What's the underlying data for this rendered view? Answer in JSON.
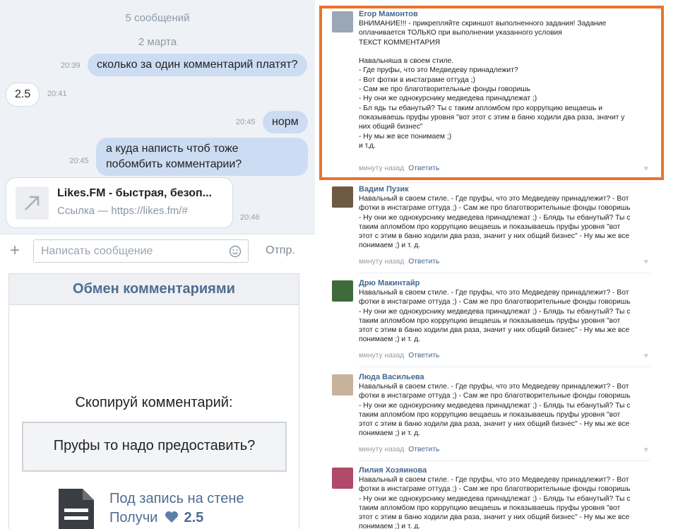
{
  "chat": {
    "header": "5 сообщений",
    "date": "2 марта",
    "messages": [
      {
        "text": "сколько за один комментарий платят?",
        "time": "20:39"
      },
      {
        "text": "2.5",
        "time": "20:41"
      },
      {
        "text": "норм",
        "time": "20:45"
      },
      {
        "text": "а куда написть чтоб тоже побомбить комментарии?",
        "time": "20:45"
      }
    ],
    "link": {
      "title": "Likes.FM - быстрая, безоп...",
      "subtitle": "Ссылка — https://likes.fm/#",
      "time": "20:46"
    },
    "composer": {
      "placeholder": "Написать сообщение",
      "send_label": "Отпр."
    }
  },
  "app": {
    "title": "Обмен комментариями",
    "copy_label": "Скопируй комментарий:",
    "comment_text": "Пруфы то надо предоставить?",
    "task_line1": "Под запись на стене",
    "task_prefix": "Получи",
    "reward": "2.5"
  },
  "comments": [
    {
      "author": "Егор Мамонтов",
      "text": "ВНИМАНИЕ!!! - прикрепляйте скриншот выполненного задания! Задание\nоплачивается ТОЛЬКО при выполнении указанного условия\nТЕКСТ КОММЕНТАРИЯ\n\nНавальняша в своем стиле.\n- Где пруфы, что это Медведеву принадлежит?\n- Вот фотки в инстаграме оттуда ;)\n- Сам же про благотворительные фонды говоришь\n- Ну они же однокурснику медведева принадлежат ;)\n- Бл ядь ты ебанутый? Ты с таким апломбом про коррупцию вещаешь и\nпоказываешь пруфы уровня \"вот этот с этим в баню ходили два раза, значит у\nних общий бизнес\"\n- Ну мы же все понимаем ;)\nи т.д.",
      "time": "минуту назад",
      "reply": "Ответить",
      "avatar_color": "#9aa7b5"
    },
    {
      "author": "Вадим Пузик",
      "text": "Навальный в своем стиле. - Где пруфы, что это Медведеву принадлежит? - Вот\nфотки в инстаграме оттуда ;) - Сам же про благотворительные фонды говоришь\n- Ну они же однокурснику медведева принадлежат ;) - Блядь ты ебанутый? Ты с\nтаким апломбом про коррупцию вещаешь и показываешь пруфы уровня \"вот\nэтот с этим в баню ходили два раза, значит у них общий бизнес\" - Ну мы же все\nпонимаем ;) и т. д.",
      "time": "минуту назад",
      "reply": "Ответить",
      "avatar_color": "#6e5a44"
    },
    {
      "author": "Дрю Макинтайр",
      "text": "Навальный в своем стиле. - Где пруфы, что это Медведеву принадлежит? - Вот\nфотки в инстаграме оттуда ;) - Сам же про благотворительные фонды говоришь\n- Ну они же однокурснику медведева принадлежат ;) - Блядь ты ебанутый? Ты с\nтаким апломбом про коррупцию вещаешь и показываешь пруфы уровня \"вот\nэтот с этим в баню ходили два раза, значит у них общий бизнес\" - Ну мы же все\nпонимаем ;) и т. д.",
      "time": "минуту назад",
      "reply": "Ответить",
      "avatar_color": "#3f6b3a"
    },
    {
      "author": "Люда Васильева",
      "text": "Навальный в своем стиле. - Где пруфы, что это Медведеву принадлежит? - Вот\nфотки в инстаграме оттуда ;) - Сам же про благотворительные фонды говоришь\n- Ну они же однокурснику медведева принадлежат ;) - Блядь ты ебанутый? Ты с\nтаким апломбом про коррупцию вещаешь и показываешь пруфы уровня \"вот\nэтот с этим в баню ходили два раза, значит у них общий бизнес\" - Ну мы же все\nпонимаем ;) и т. д.",
      "time": "минуту назад",
      "reply": "Ответить",
      "avatar_color": "#c7b39c"
    },
    {
      "author": "Лилия Хозяинова",
      "text": "Навальный в своем стиле. - Где пруфы, что это Медведеву принадлежит? - Вот\nфотки в инстаграме оттуда ;) - Сам же про благотворительные фонды говоришь\n- Ну они же однокурснику медведева принадлежат ;) - Блядь ты ебанутый? Ты с\nтаким апломбом про коррупцию вещаешь и показываешь пруфы уровня \"вот\nэтот с этим в баню ходили два раза, значит у них общий бизнес\" - Ну мы же все\nпонимаем ;) и т. д.",
      "time": "",
      "reply": "",
      "avatar_color": "#b04a6a"
    }
  ]
}
